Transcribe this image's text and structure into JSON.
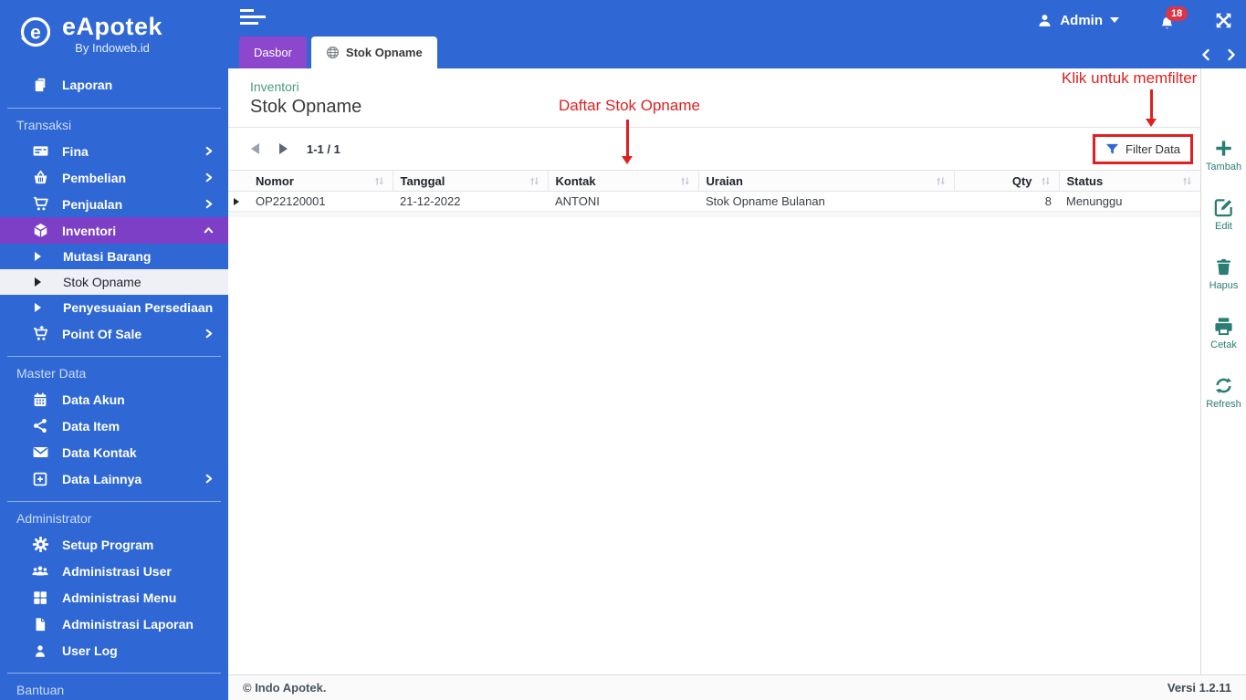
{
  "brand": {
    "name": "eApotek",
    "tagline": "By Indoweb.id"
  },
  "sidebar": {
    "laporan": "Laporan",
    "transaksi": {
      "title": "Transaksi",
      "fina": "Fina",
      "pembelian": "Pembelian",
      "penjualan": "Penjualan",
      "inventori": "Inventori",
      "mutasi_barang": "Mutasi Barang",
      "stok_opname": "Stok Opname",
      "penyesuaian": "Penyesuaian Persediaan",
      "pos": "Point Of Sale"
    },
    "master": {
      "title": "Master Data",
      "data_akun": "Data Akun",
      "data_item": "Data Item",
      "data_kontak": "Data Kontak",
      "data_lainnya": "Data Lainnya"
    },
    "admin": {
      "title": "Administrator",
      "setup": "Setup Program",
      "adm_user": "Administrasi User",
      "adm_menu": "Administrasi Menu",
      "adm_laporan": "Administrasi Laporan",
      "user_log": "User Log"
    },
    "bantuan": {
      "title": "Bantuan"
    }
  },
  "topbar": {
    "user_label": "Admin",
    "notification_count": "18",
    "tabs": {
      "dasbor": "Dasbor",
      "stok_opname": "Stok Opname"
    }
  },
  "page": {
    "breadcrumb": "Inventori",
    "title": "Stok Opname"
  },
  "annotations": {
    "list_label": "Daftar Stok Opname",
    "filter_hint": "Klik untuk memfilter"
  },
  "toolbar": {
    "pagination": "1-1 / 1",
    "filter_label": "Filter Data"
  },
  "table": {
    "headers": {
      "nomor": "Nomor",
      "tanggal": "Tanggal",
      "kontak": "Kontak",
      "uraian": "Uraian",
      "qty": "Qty",
      "status": "Status"
    },
    "rows": [
      {
        "nomor": "OP22120001",
        "tanggal": "21-12-2022",
        "kontak": "ANTONI",
        "uraian": "Stok Opname Bulanan",
        "qty": "8",
        "status": "Menunggu"
      }
    ]
  },
  "actions": {
    "tambah": "Tambah",
    "edit": "Edit",
    "hapus": "Hapus",
    "cetak": "Cetak",
    "refresh": "Refresh"
  },
  "footer": {
    "copyright": "© Indo Apotek.",
    "version": "Versi 1.2.11"
  },
  "icons": {
    "menu_toggle": "hamburger-lines",
    "notification": "bell-with-badge",
    "fullscreen": "expand-arrows",
    "user": "person-silhouette",
    "tab_globe": "globe",
    "filter": "funnel",
    "sort": "up-down-arrows",
    "pagination_prev": "left-triangle",
    "pagination_next": "right-triangle",
    "row_expander": "right-triangle"
  },
  "colors": {
    "primary_blue": "#2f68d5",
    "tab_purple": "#8d47cd",
    "active_menu_purple": "#7d3fc6",
    "selected_menu_bg": "#eef0f5",
    "action_teal": "#2a7d74",
    "annotation_red": "#e01f1f",
    "breadcrumb_green": "#4a9b7c",
    "badge_red": "#dc3545"
  }
}
